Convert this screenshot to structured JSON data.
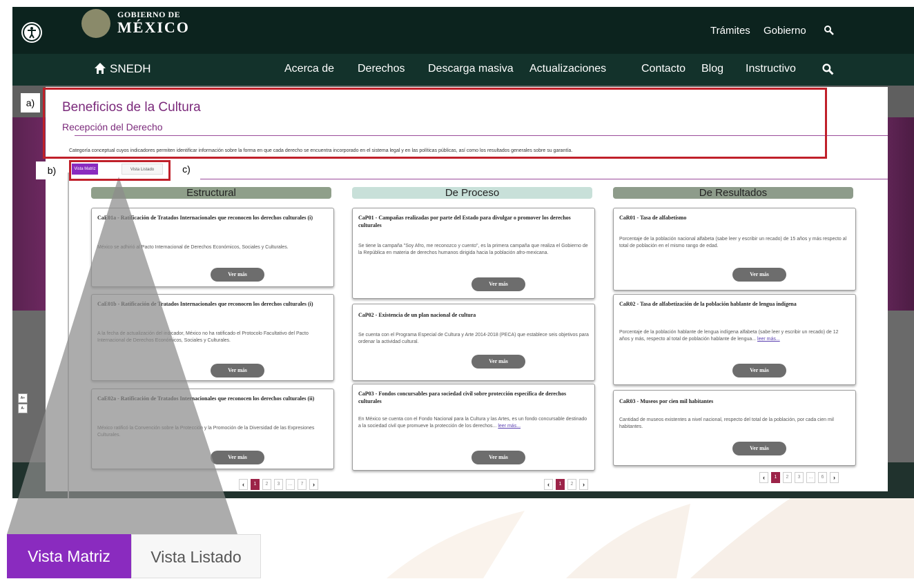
{
  "colors": {
    "header_dark": "#0c231e",
    "nav_green": "#13322b",
    "title_purple": "#7b2a7b",
    "tab_active_purple": "#8a2bbf",
    "annotation_red": "#c0202a",
    "page_active": "#9c2348",
    "col_estructural": "#8f9f8a",
    "col_proceso": "#c8e0d9",
    "col_resultados": "#8e9c8b"
  },
  "header": {
    "brand_small": "GOBIERNO DE",
    "brand_big": "MÉXICO",
    "links": [
      "Trámites",
      "Gobierno"
    ],
    "icons": [
      "accessibility-icon",
      "search-icon"
    ]
  },
  "nav": {
    "home_label": "SNEDH",
    "links": [
      "Acerca de",
      "Derechos",
      "Descarga masiva",
      "Actualizaciones",
      "Contacto",
      "Blog",
      "Instructivo"
    ]
  },
  "page": {
    "title": "Beneficios de la Cultura",
    "subtitle": "Recepción del Derecho",
    "description": "Categoría conceptual cuyos indicadores permiten identificar información sobre la forma en que cada derecho se encuentra incorporado en el sistema legal y en las políticas públicas, así como los resultados generales sobre su garantía."
  },
  "tabs": {
    "matrix": "Vista Matriz",
    "list": "Vista Listado"
  },
  "annotations": {
    "a": "a)",
    "b": "b)",
    "c": "c)"
  },
  "text_size_buttons": [
    "A+",
    "A-"
  ],
  "columns": [
    {
      "heading": "Estructural",
      "cards": [
        {
          "title": "CaE01a - Ratificación de Tratados Internacionales que reconocen los derechos culturales (i)",
          "body": "México se adhirió al Pacto Internacional de Derechos Económicos, Sociales y Culturales.",
          "button": "Ver más"
        },
        {
          "title": "CaE01b - Ratificación de Tratados Internacionales que reconocen los derechos culturales (i)",
          "body": "A la fecha de actualización del indicador, México no ha ratificado el Protocolo Facultativo del Pacto Internacional de Derechos Económicos, Sociales y Culturales.",
          "button": "Ver más"
        },
        {
          "title": "CaE02a - Ratificación de Tratados Internacionales que reconocen los derechos culturales (ii)",
          "body": "México ratificó la Convención sobre la Protección y la Promoción de la Diversidad de las Expresiones Culturales.",
          "button": "Ver más"
        }
      ],
      "pager": [
        "‹",
        "1",
        "2",
        "3",
        "...",
        "7",
        "›"
      ]
    },
    {
      "heading": "De Proceso",
      "cards": [
        {
          "title": "CaP01 - Campañas realizadas por parte del Estado para divulgar o promover los derechos culturales",
          "body": "Se tiene la campaña \"Soy Afro, me reconozco y cuento\", es la primera campaña que realiza el Gobierno de la República en materia de derechos humanos dirigida hacia la población afro-mexicana.",
          "button": "Ver más"
        },
        {
          "title": "CaP02 - Existencia de un plan nacional de cultura",
          "body": "Se cuenta con el Programa Especial de Cultura y Arte 2014-2018 (PECA) que establece seis objetivos para ordenar la actividad cultural.",
          "button": "Ver más"
        },
        {
          "title": "CaP03 - Fondos concursables para sociedad civil sobre protección específica de derechos culturales",
          "body": "En México se cuenta con el Fondo Nacional para la Cultura y las Artes, es un fondo concursable destinado a la sociedad civil que promueve la protección de los derechos...",
          "link": "leer más...",
          "button": "Ver más"
        }
      ],
      "pager": [
        "‹",
        "1",
        "2",
        "›"
      ]
    },
    {
      "heading": "De Resultados",
      "cards": [
        {
          "title": "CaR01 - Tasa de alfabetismo",
          "body": "Porcentaje de la población nacional alfabeta (sabe leer y escribir un recado) de 15 años y más respecto al total de población en el mismo rango de edad.",
          "button": "Ver más"
        },
        {
          "title": "CaR02 - Tasa de alfabetización de la población hablante de lengua indígena",
          "body": "Porcentaje de la población hablante de lengua indígena alfabeta (sabe leer y escribir un recado) de 12 años y más, respecto al total de población hablante de lengua...",
          "link": "leer más...",
          "button": "Ver más"
        },
        {
          "title": "CaR03 - Museos por cien mil habitantes",
          "body": "Cantidad de museos existentes a nivel nacional, respecto del total de la población, por cada cien mil habitantes.",
          "button": "Ver más"
        }
      ],
      "pager": [
        "‹",
        "1",
        "2",
        "3",
        "...",
        "6",
        "›"
      ]
    }
  ]
}
